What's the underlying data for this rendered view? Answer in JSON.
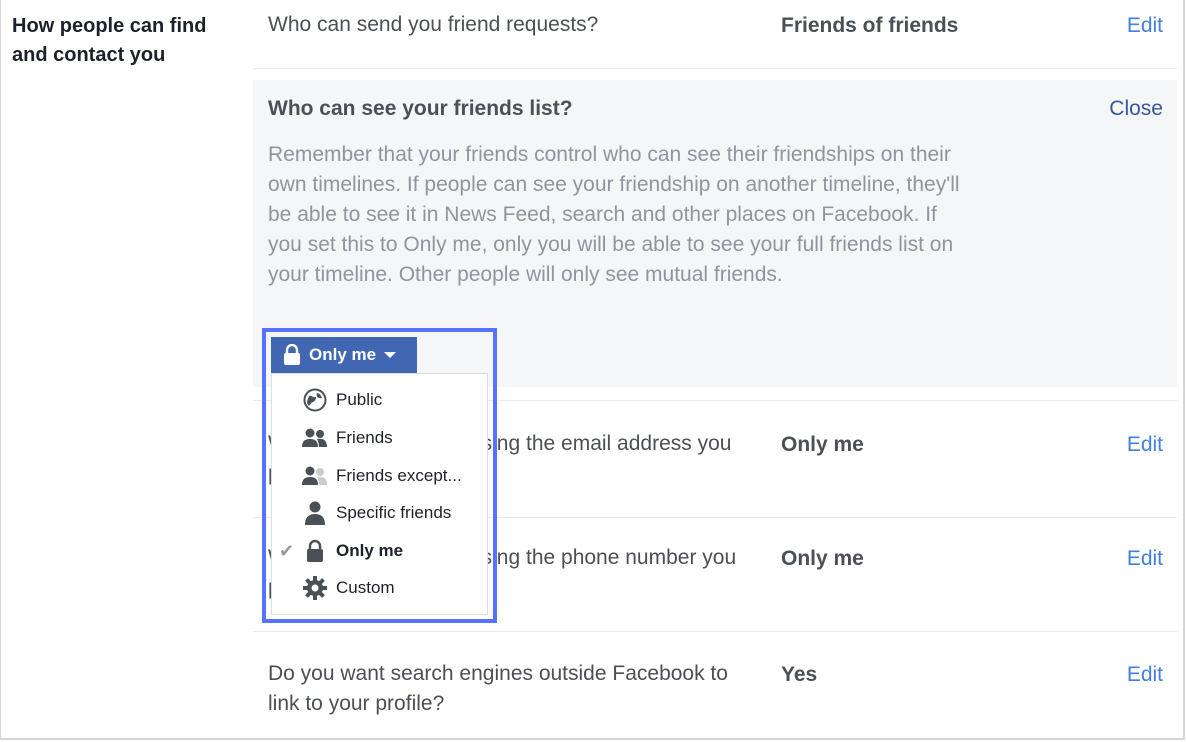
{
  "section": {
    "title": "How people can find and contact you"
  },
  "rows": [
    {
      "question": "Who can send you friend requests?",
      "value": "Friends of friends",
      "action": "Edit"
    },
    {
      "question": "Who can look you up using the email address you provided?",
      "value": "Only me",
      "action": "Edit"
    },
    {
      "question": "Who can look you up using the phone number you provided?",
      "value": "Only me",
      "action": "Edit"
    },
    {
      "question": "Do you want search engines outside Facebook to link to your profile?",
      "value": "Yes",
      "action": "Edit"
    }
  ],
  "expanded": {
    "title": "Who can see your friends list?",
    "close": "Close",
    "description": "Remember that your friends control who can see their friendships on their own timelines. If people can see your friendship on another timeline, they'll be able to see it in News Feed, search and other places on Facebook. If you set this to Only me, only you will be able to see your full friends list on your timeline. Other people will only see mutual friends.",
    "audience_button": {
      "label": "Only me",
      "icon": "lock-icon"
    },
    "menu": [
      {
        "label": "Public",
        "icon": "globe-icon",
        "selected": false
      },
      {
        "label": "Friends",
        "icon": "friends-icon",
        "selected": false
      },
      {
        "label": "Friends except...",
        "icon": "friends-except-icon",
        "selected": false
      },
      {
        "label": "Specific friends",
        "icon": "person-icon",
        "selected": false
      },
      {
        "label": "Only me",
        "icon": "lock-icon",
        "selected": true
      },
      {
        "label": "Custom",
        "icon": "gear-icon",
        "selected": false
      }
    ]
  },
  "colors": {
    "button": "#4267b2",
    "link": "#4080e0",
    "highlight": "#5672ff"
  }
}
